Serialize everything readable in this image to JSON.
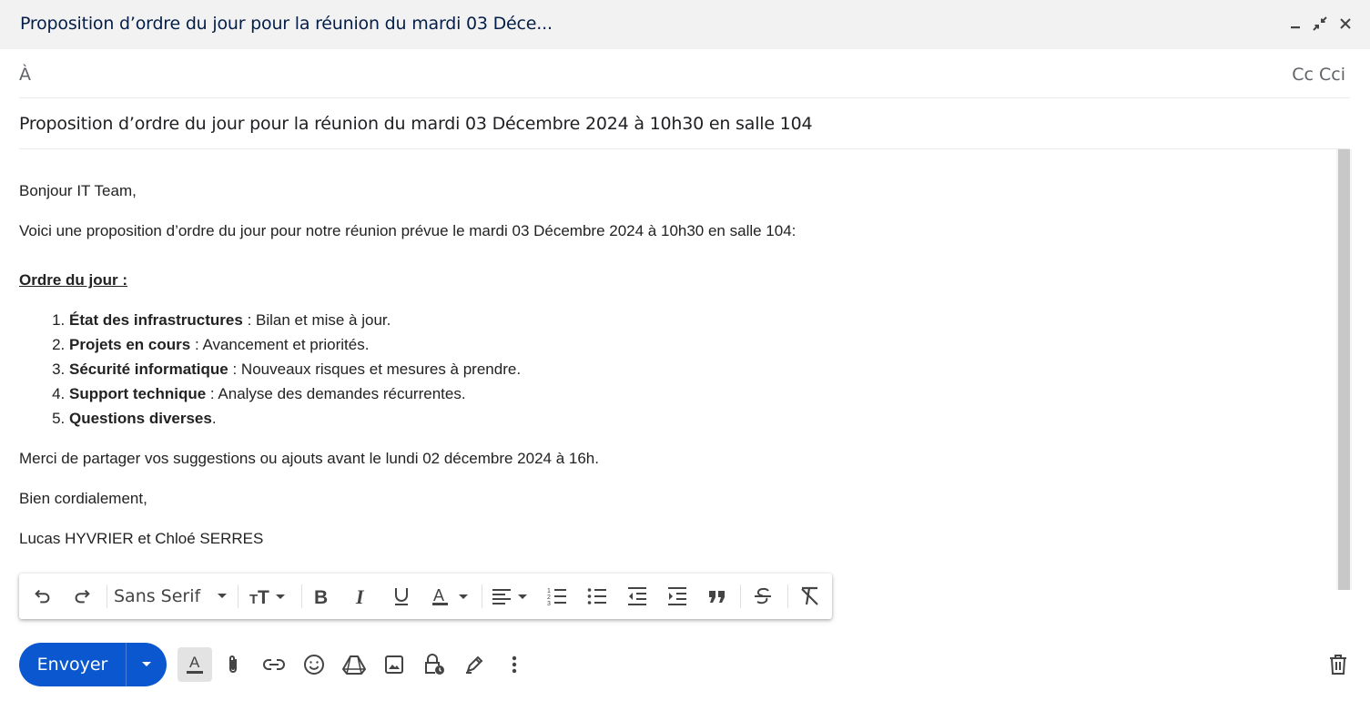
{
  "window": {
    "title": "Proposition d’ordre du jour pour la réunion du mardi 03 Déce...",
    "minimize_icon": "minimize-icon",
    "exit_fullscreen_icon": "exit-fullscreen-icon",
    "close_icon": "close-icon"
  },
  "recipients": {
    "to_label": "À",
    "cc_label": "Cc",
    "bcc_label": "Cci"
  },
  "subject": "Proposition d’ordre du jour pour la réunion du mardi 03 Décembre 2024 à 10h30 en salle 104",
  "message": {
    "greeting": "Bonjour IT Team,",
    "intro": "Voici une proposition d’ordre du jour pour notre réunion prévue le mardi 03 Décembre 2024 à 10h30 en salle 104:",
    "agenda_heading": "Ordre du jour :",
    "agenda": [
      {
        "bold": "État des infrastructures",
        "rest": " : Bilan et mise à jour."
      },
      {
        "bold": "Projets en cours",
        "rest": " : Avancement et priorités."
      },
      {
        "bold": "Sécurité informatique",
        "rest": " : Nouveaux risques et mesures à prendre."
      },
      {
        "bold": "Support technique",
        "rest": " : Analyse des demandes récurrentes."
      },
      {
        "bold": "Questions diverses",
        "rest": "."
      }
    ],
    "request": "Merci de partager vos suggestions ou ajouts avant le lundi 02 décembre 2024 à 16h.",
    "closing": "Bien cordialement,",
    "signature": "Lucas HYVRIER et Chloé SERRES"
  },
  "format_toolbar": {
    "font_name": "Sans Serif",
    "icons": [
      "undo-icon",
      "redo-icon",
      "font-size-icon",
      "bold-icon",
      "italic-icon",
      "underline-icon",
      "text-color-icon",
      "align-icon",
      "numbered-list-icon",
      "bulleted-list-icon",
      "indent-less-icon",
      "indent-more-icon",
      "quote-icon",
      "strikethrough-icon",
      "remove-formatting-icon"
    ]
  },
  "bottom_toolbar": {
    "send_label": "Envoyer",
    "icons": [
      "formatting-options-icon",
      "attach-icon",
      "link-icon",
      "emoji-icon",
      "drive-icon",
      "photo-icon",
      "confidential-mode-icon",
      "signature-icon",
      "more-options-icon",
      "delete-icon"
    ]
  },
  "colors": {
    "send_button": "#0b57d0",
    "title_bar": "#f2f2f2",
    "title_text": "#041e49"
  }
}
